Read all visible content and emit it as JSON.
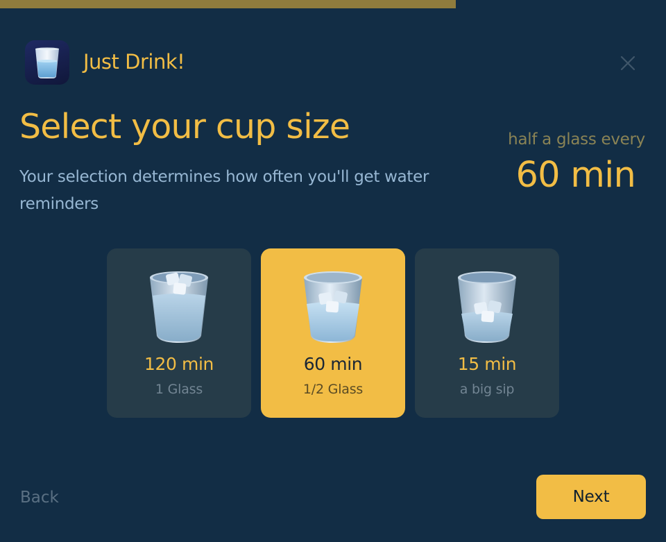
{
  "progress": {
    "fraction": 0.684
  },
  "header": {
    "app_name": "Just Drink!",
    "app_icon": "glass-of-water-icon",
    "close_icon": "close-icon"
  },
  "main": {
    "title": "Select your cup size",
    "subtitle": "Your selection determines how often you'll get water reminders"
  },
  "summary": {
    "label": "half a glass every",
    "value": "60 min"
  },
  "cups": [
    {
      "time": "120 min",
      "desc": "1 Glass",
      "selected": false,
      "icon": "glass-of-water-icon"
    },
    {
      "time": "60 min",
      "desc": "1/2 Glass",
      "selected": true,
      "icon": "glass-of-water-icon"
    },
    {
      "time": "15 min",
      "desc": "a big sip",
      "selected": false,
      "icon": "glass-of-water-icon"
    }
  ],
  "footer": {
    "back_label": "Back",
    "next_label": "Next"
  },
  "colors": {
    "background": "#122d45",
    "accent": "#f2bd45",
    "card": "#263c49",
    "subtitle": "#97b7d3",
    "progress": "#8f7c3d"
  }
}
